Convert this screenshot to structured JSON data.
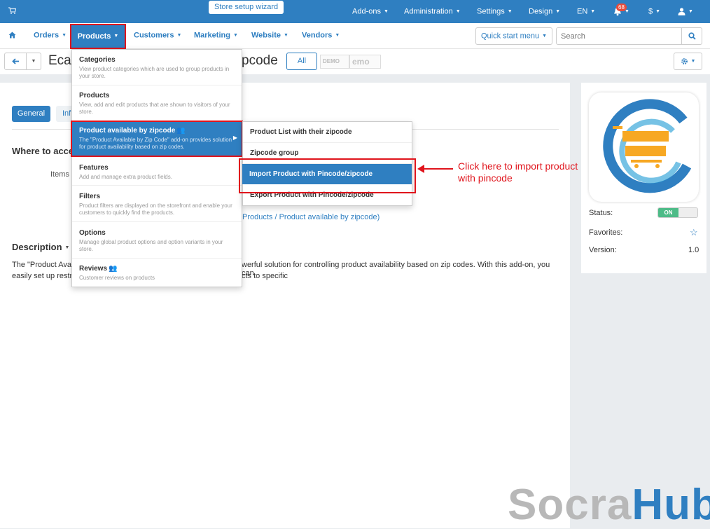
{
  "topbar": {
    "wizard": "Store setup wizard",
    "menus": [
      "Add-ons",
      "Administration",
      "Settings",
      "Design",
      "EN"
    ],
    "notification_count": "68",
    "currency": "$"
  },
  "nav": {
    "items": [
      "Orders",
      "Products",
      "Customers",
      "Marketing",
      "Website",
      "Vendors"
    ],
    "quick_start": "Quick start menu",
    "search_placeholder": "Search"
  },
  "header": {
    "title_left": "Eca",
    "title_right": "pcode",
    "all_label": "All",
    "store_logo_1": "DEMO ST",
    "store_logo_2": "emo Sto"
  },
  "tabs": {
    "general": "General",
    "info": "Inf"
  },
  "content": {
    "where_heading": "Where to acce",
    "items_label": "Items",
    "path_link": "Products / Product available by zipcode)",
    "description_heading": "Description",
    "desc_1": "The \"Product Avai",
    "desc_2": "werful solution for controlling product availability based on zip codes. With this add-on, you can",
    "desc_3": "easily set up restri",
    "desc_4": "cts to specific"
  },
  "dropdown": {
    "items": [
      {
        "title": "Categories",
        "desc": "View product categories which are used to group products in your store."
      },
      {
        "title": "Products",
        "desc": "View, add and edit products that are shown to visitors of your store."
      },
      {
        "title": "Product available by zipcode",
        "desc": "The \"Product Available by Zip Code\" add-on provides solution for product availability based on zip codes."
      },
      {
        "title": "Features",
        "desc": "Add and manage extra product fields."
      },
      {
        "title": "Filters",
        "desc": "Product filters are displayed on the storefront and enable your customers to quickly find the products."
      },
      {
        "title": "Options",
        "desc": "Manage global product options and option variants in your store."
      },
      {
        "title": "Reviews",
        "desc": "Customer reviews on products"
      }
    ]
  },
  "submenu": {
    "items": [
      "Product List with their zipcode",
      "Zipcode group",
      "Import Product with Pincode/zipcode",
      "Export Product with Pincode/zipcode"
    ]
  },
  "annotation": "Click here to import product with pincode",
  "side": {
    "status_label": "Status:",
    "status_value": "ON",
    "favorites_label": "Favorites:",
    "version_label": "Version:",
    "version_value": "1.0"
  },
  "watermark": {
    "part1": "Socra",
    "part2": "Hub"
  },
  "colors": {
    "primary": "#2f7fc1",
    "highlight": "#e0141c",
    "on": "#4dbb87",
    "logo_orange": "#f7a823"
  },
  "icons": [
    "cart-icon",
    "bell-icon",
    "user-icon",
    "home-icon",
    "search-icon",
    "arrow-left-icon",
    "gear-icon",
    "star-icon",
    "person-icon",
    "chevron-right-icon"
  ]
}
